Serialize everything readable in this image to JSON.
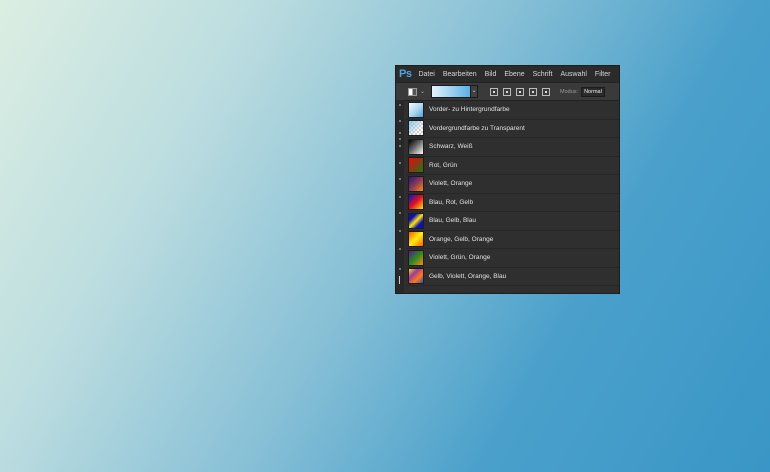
{
  "app": {
    "logo": "Ps",
    "menu": [
      "Datei",
      "Bearbeiten",
      "Bild",
      "Ebene",
      "Schrift",
      "Auswahl",
      "Filter"
    ]
  },
  "options": {
    "mode_label": "Modus:",
    "mode_value": "Normal"
  },
  "gradients": [
    {
      "label": "Vorder- zu Hintergrundfarbe",
      "css": "linear-gradient(135deg,#f5fbff 0%,#a9d5ee 55%,#4aa3d8 100%)"
    },
    {
      "label": "Vordergrundfarbe zu Transparent",
      "css": "checker"
    },
    {
      "label": "Schwarz, Weiß",
      "css": "linear-gradient(135deg,#000 0%,#666 45%,#fff 100%)"
    },
    {
      "label": "Rot, Grün",
      "css": "linear-gradient(135deg,#e01010 0%,#8a3a12 50%,#1f7a12 100%)"
    },
    {
      "label": "Violett, Orange",
      "css": "linear-gradient(135deg,#2a1a7a 0%,#8a3a55 50%,#ff8a10 100%)"
    },
    {
      "label": "Blau, Rot, Gelb",
      "css": "linear-gradient(135deg,#1010c8 0%,#e01020 50%,#ffe010 100%)"
    },
    {
      "label": "Blau, Gelb, Blau",
      "css": "linear-gradient(135deg,#1010b0 0%,#1010b0 25%,#ffe610 50%,#1010b0 75%,#1010b0 100%)"
    },
    {
      "label": "Orange, Gelb, Orange",
      "css": "linear-gradient(135deg,#ff5a08 0%,#ffee10 50%,#ff5a08 100%)"
    },
    {
      "label": "Violett, Grün, Orange",
      "css": "linear-gradient(135deg,#5a1a90 0%,#2a8a20 50%,#ff8a10 100%)"
    },
    {
      "label": "Gelb, Violett, Orange, Blau",
      "css": "linear-gradient(135deg,#ffe010 0%,#a03aa0 33%,#ff7a10 66%,#2050d0 100%)"
    }
  ]
}
